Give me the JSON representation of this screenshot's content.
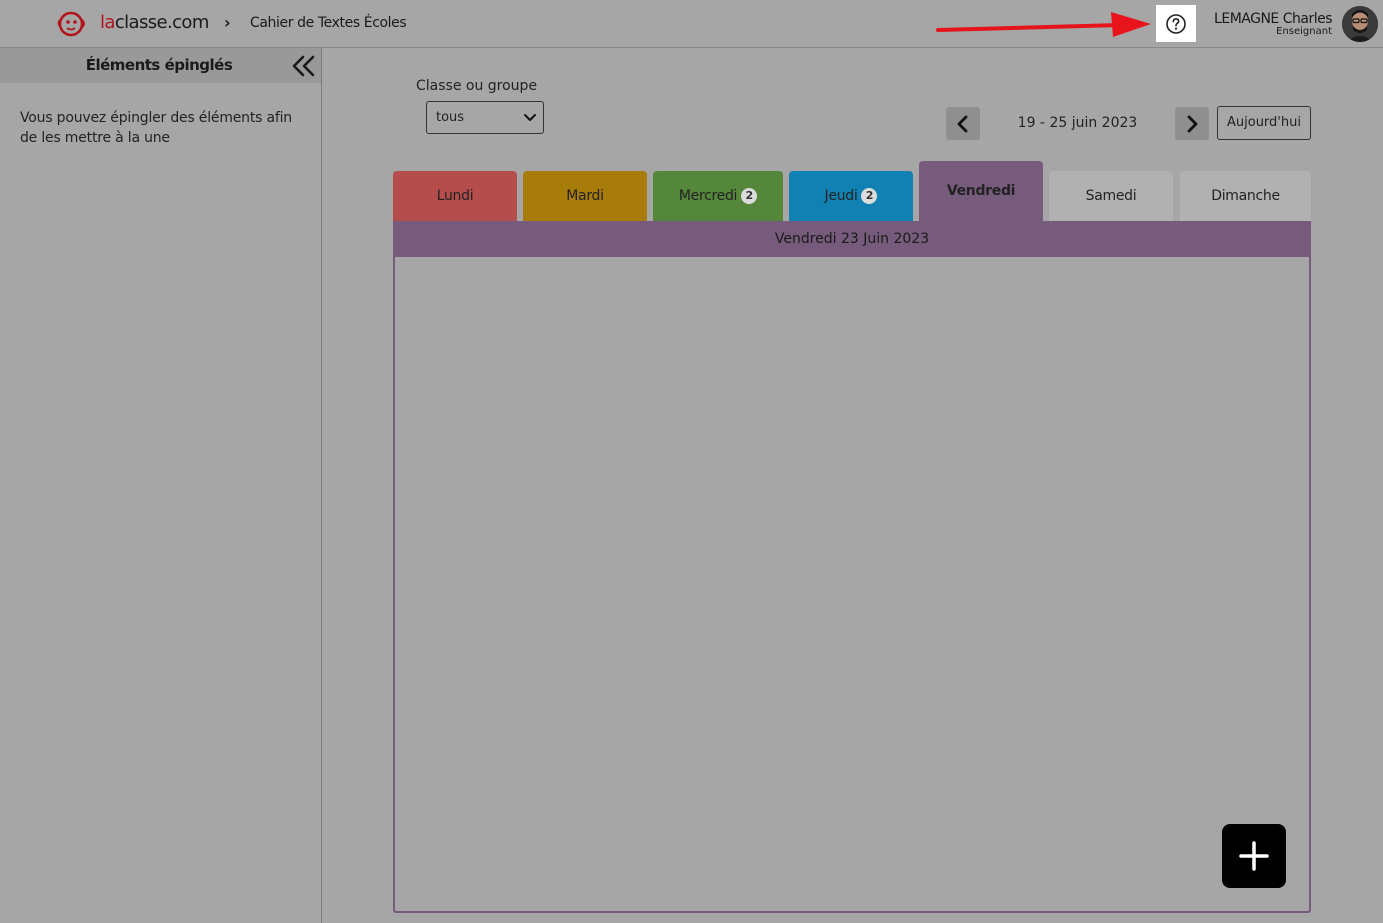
{
  "app": {
    "logo_prefix": "la",
    "logo_suffix": "classe.com",
    "breadcrumb_separator": "›",
    "breadcrumb_title": "Cahier de Textes Écoles"
  },
  "user": {
    "name": "LEMAGNE Charles",
    "role": "Enseignant"
  },
  "sidebar": {
    "title": "Éléments épinglés",
    "empty_text": "Vous pouvez épingler des éléments afin de les mettre à la une"
  },
  "filter": {
    "label": "Classe ou groupe",
    "selected": "tous"
  },
  "week": {
    "range": "19 - 25 juin 2023",
    "today_label": "Aujourd'hui"
  },
  "tabs": [
    {
      "label": "Lundi",
      "badge": "",
      "color": "#b54d4d"
    },
    {
      "label": "Mardi",
      "badge": "",
      "color": "#a87c0a"
    },
    {
      "label": "Mercredi",
      "badge": "2",
      "color": "#54873a"
    },
    {
      "label": "Jeudi",
      "badge": "2",
      "color": "#1180b3"
    },
    {
      "label": "Vendredi",
      "badge": "",
      "color": "#765b7c",
      "active": true
    },
    {
      "label": "Samedi",
      "badge": "",
      "color": "#b1b1b1"
    },
    {
      "label": "Dimanche",
      "badge": "",
      "color": "#b1b1b1"
    }
  ],
  "day": {
    "header": "Vendredi 23 Juin 2023"
  },
  "colors": {
    "accent_red": "#b2141c",
    "annotation_arrow": "#e8141c",
    "page_bg": "#a6a6a6"
  }
}
